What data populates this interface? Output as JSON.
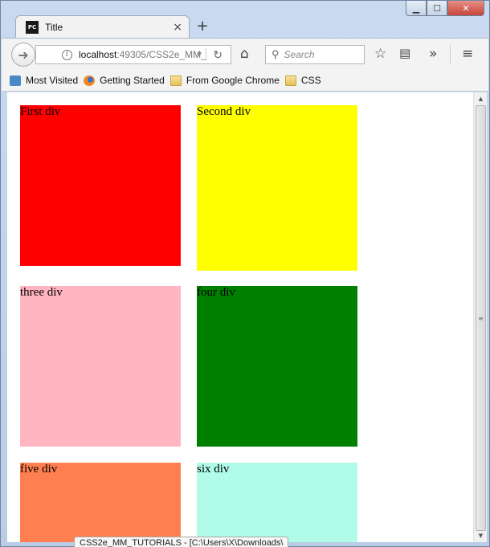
{
  "tab": {
    "title": "Title",
    "favicon_text": "PC",
    "close_label": "×"
  },
  "new_tab_label": "+",
  "address": {
    "host": "localhost",
    "path": ":49305/CSS2e_MM_"
  },
  "search": {
    "placeholder": "Search"
  },
  "bookmarks": [
    {
      "label": "Most Visited",
      "icon": "most-visited-icon"
    },
    {
      "label": "Getting Started",
      "icon": "firefox-icon"
    },
    {
      "label": "From Google Chrome",
      "icon": "folder-icon"
    },
    {
      "label": "CSS",
      "icon": "folder-icon"
    }
  ],
  "boxes": [
    {
      "label": "First div",
      "color": "#ff0000"
    },
    {
      "label": "Second div",
      "color": "#ffff00"
    },
    {
      "label": "three div",
      "color": "#ffb6c1"
    },
    {
      "label": "four div",
      "color": "#008000"
    },
    {
      "label": "five div",
      "color": "#ff7f50"
    },
    {
      "label": "six div",
      "color": "#b0fce9"
    }
  ],
  "status": "CSS2e_MM_TUTORIALS - [C:\\Users\\X\\Downloads\\"
}
